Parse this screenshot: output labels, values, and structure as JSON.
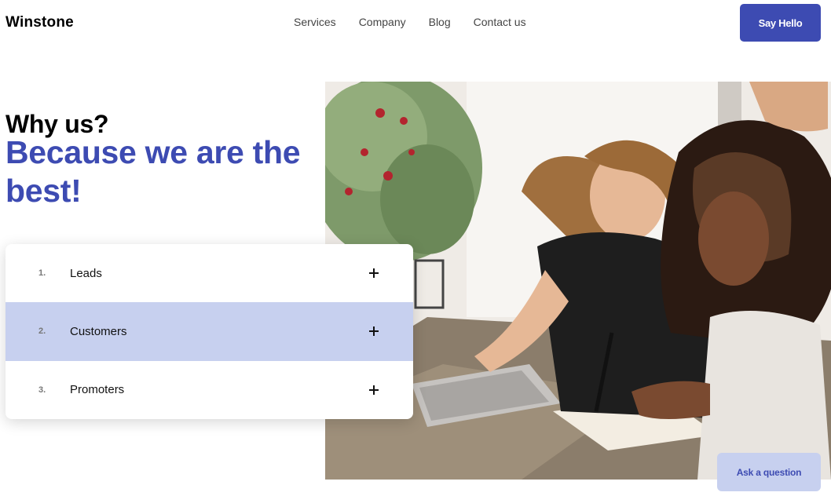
{
  "header": {
    "logo": "Winstone",
    "nav": [
      {
        "label": "Services"
      },
      {
        "label": "Company"
      },
      {
        "label": "Blog"
      },
      {
        "label": "Contact us"
      }
    ],
    "cta_label": "Say Hello"
  },
  "hero": {
    "heading": "Why us?",
    "subheading": "Because we are the best!"
  },
  "accordion": {
    "items": [
      {
        "number": "1.",
        "label": "Leads",
        "active": false
      },
      {
        "number": "2.",
        "label": "Customers",
        "active": true
      },
      {
        "number": "3.",
        "label": "Promoters",
        "active": false
      }
    ],
    "expand_icon": "plus-icon"
  },
  "chat": {
    "label": "Ask a question"
  },
  "colors": {
    "brand": "#3d4bb2",
    "accent_light": "#c7d0ef"
  }
}
